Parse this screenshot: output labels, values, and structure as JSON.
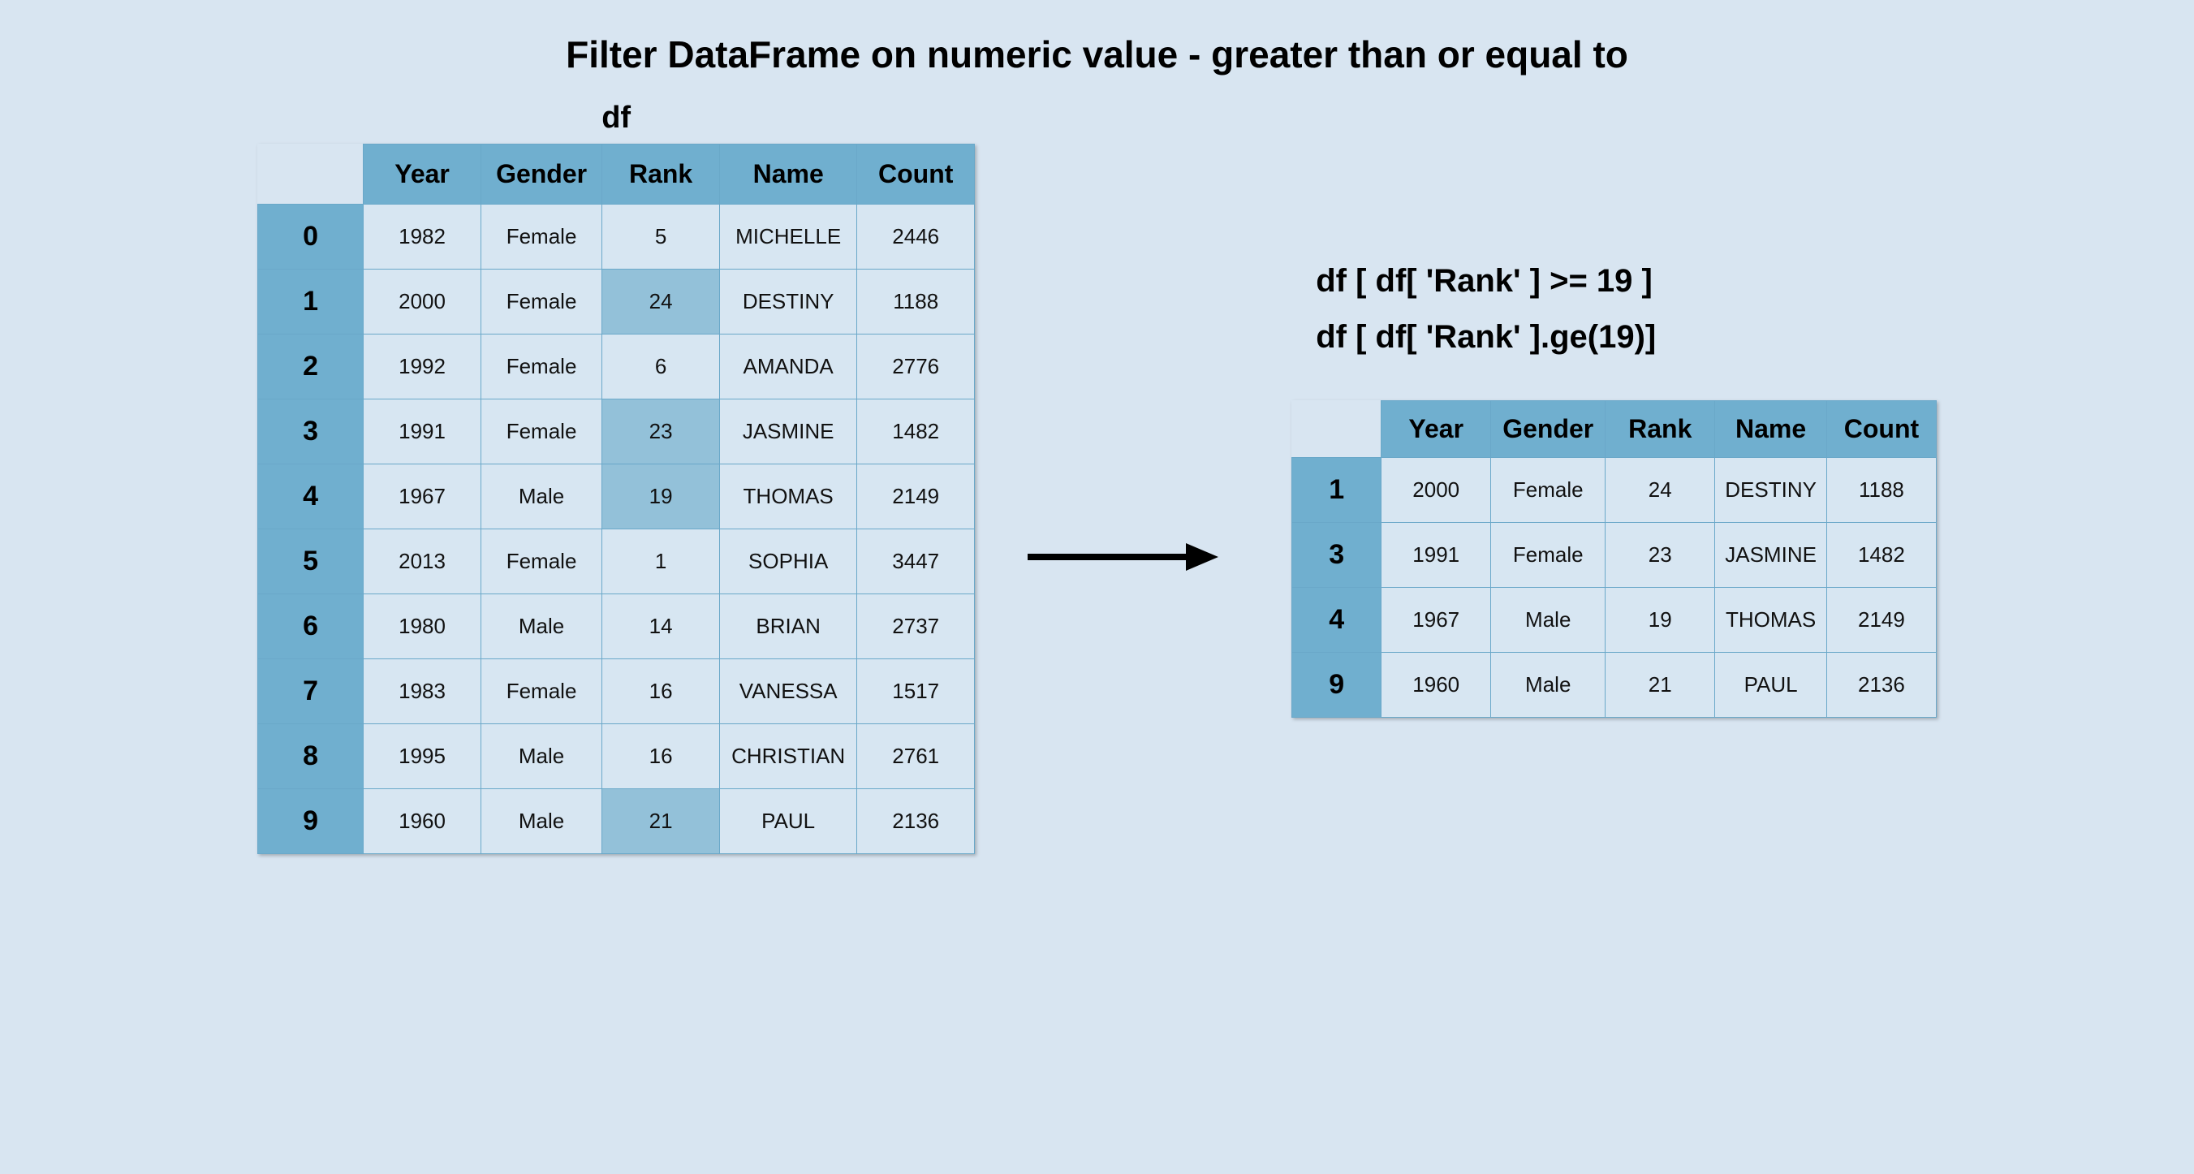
{
  "title": "Filter DataFrame on numeric value - greater than or equal to",
  "left": {
    "label": "df",
    "columns": [
      "Year",
      "Gender",
      "Rank",
      "Name",
      "Count"
    ],
    "rows": [
      {
        "idx": "0",
        "year": "1982",
        "gender": "Female",
        "rank": "5",
        "name": "MICHELLE",
        "count": "2446",
        "hl": false
      },
      {
        "idx": "1",
        "year": "2000",
        "gender": "Female",
        "rank": "24",
        "name": "DESTINY",
        "count": "1188",
        "hl": true
      },
      {
        "idx": "2",
        "year": "1992",
        "gender": "Female",
        "rank": "6",
        "name": "AMANDA",
        "count": "2776",
        "hl": false
      },
      {
        "idx": "3",
        "year": "1991",
        "gender": "Female",
        "rank": "23",
        "name": "JASMINE",
        "count": "1482",
        "hl": true
      },
      {
        "idx": "4",
        "year": "1967",
        "gender": "Male",
        "rank": "19",
        "name": "THOMAS",
        "count": "2149",
        "hl": true
      },
      {
        "idx": "5",
        "year": "2013",
        "gender": "Female",
        "rank": "1",
        "name": "SOPHIA",
        "count": "3447",
        "hl": false
      },
      {
        "idx": "6",
        "year": "1980",
        "gender": "Male",
        "rank": "14",
        "name": "BRIAN",
        "count": "2737",
        "hl": false
      },
      {
        "idx": "7",
        "year": "1983",
        "gender": "Female",
        "rank": "16",
        "name": "VANESSA",
        "count": "1517",
        "hl": false
      },
      {
        "idx": "8",
        "year": "1995",
        "gender": "Male",
        "rank": "16",
        "name": "CHRISTIAN",
        "count": "2761",
        "hl": false
      },
      {
        "idx": "9",
        "year": "1960",
        "gender": "Male",
        "rank": "21",
        "name": "PAUL",
        "count": "2136",
        "hl": true
      }
    ]
  },
  "right": {
    "code1": "df [ df[ 'Rank' ] >= 19 ]",
    "code2": "df [ df[ 'Rank' ].ge(19)]",
    "columns": [
      "Year",
      "Gender",
      "Rank",
      "Name",
      "Count"
    ],
    "rows": [
      {
        "idx": "1",
        "year": "2000",
        "gender": "Female",
        "rank": "24",
        "name": "DESTINY",
        "count": "1188"
      },
      {
        "idx": "3",
        "year": "1991",
        "gender": "Female",
        "rank": "23",
        "name": "JASMINE",
        "count": "1482"
      },
      {
        "idx": "4",
        "year": "1967",
        "gender": "Male",
        "rank": "19",
        "name": "THOMAS",
        "count": "2149"
      },
      {
        "idx": "9",
        "year": "1960",
        "gender": "Male",
        "rank": "21",
        "name": "PAUL",
        "count": "2136"
      }
    ]
  }
}
